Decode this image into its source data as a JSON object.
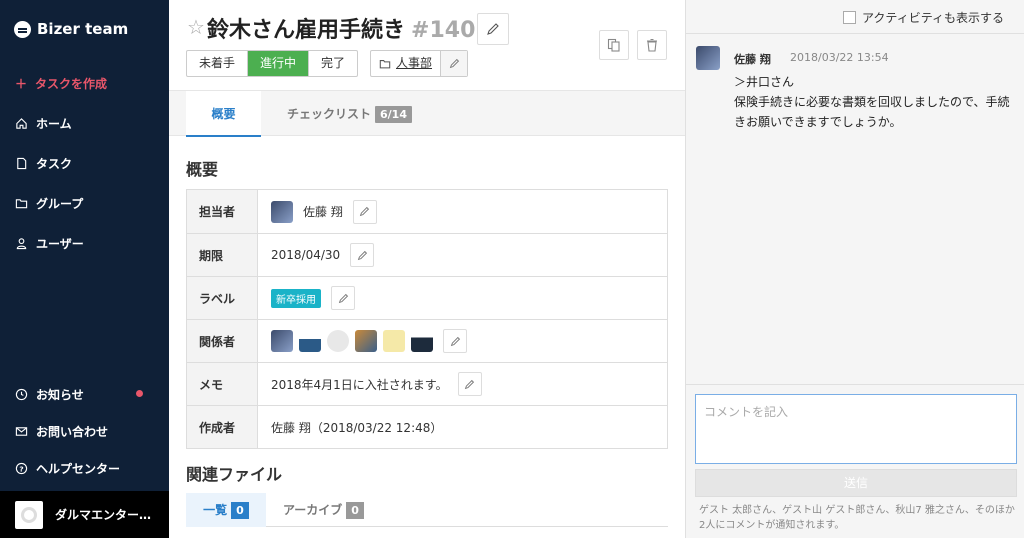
{
  "sidebar": {
    "brand": "Bizer team",
    "create": "タスクを作成",
    "items": [
      "ホーム",
      "タスク",
      "グループ",
      "ユーザー"
    ],
    "bottom": [
      "お知らせ",
      "お問い合わせ",
      "ヘルプセンター"
    ],
    "account": "ダルマエンター…"
  },
  "task": {
    "title": "鈴木さん雇用手続き",
    "number": "#140",
    "statuses": [
      "未着手",
      "進行中",
      "完了"
    ],
    "active_status": "進行中",
    "group": "人事部"
  },
  "tabs": {
    "overview": "概要",
    "checklist": "チェックリスト",
    "checklist_count": "6/14"
  },
  "overview": {
    "heading": "概要",
    "rows": {
      "assignee_label": "担当者",
      "assignee": "佐藤 翔",
      "due_label": "期限",
      "due": "2018/04/30",
      "label_label": "ラベル",
      "label": "新卒採用",
      "related_label": "関係者",
      "memo_label": "メモ",
      "memo": "2018年4月1日に入社されます。",
      "creator_label": "作成者",
      "creator": "佐藤 翔（2018/03/22 12:48）"
    }
  },
  "files": {
    "heading": "関連ファイル",
    "list": "一覧",
    "list_count": "0",
    "archive": "アーカイブ",
    "archive_count": "0"
  },
  "activity": {
    "toggle": "アクティビティも表示する"
  },
  "comment": {
    "author": "佐藤 翔",
    "time": "2018/03/22 13:54",
    "line1": "＞井口さん",
    "line2": "保険手続きに必要な書類を回収しましたので、手続きお願いできますでしょうか。"
  },
  "compose": {
    "placeholder": "コメントを記入",
    "send": "送信",
    "notice": "ゲスト 太郎さん、ゲスト山 ゲスト郎さん、秋山7 雅之さん、そのほか2人にコメントが通知されます。"
  },
  "colors": {
    "sidebar": "#0f2037",
    "accent": "#2a7fc9",
    "active_status": "#4caf50",
    "label_chip": "#1ab3c8",
    "notify_dot": "#e8566a"
  }
}
